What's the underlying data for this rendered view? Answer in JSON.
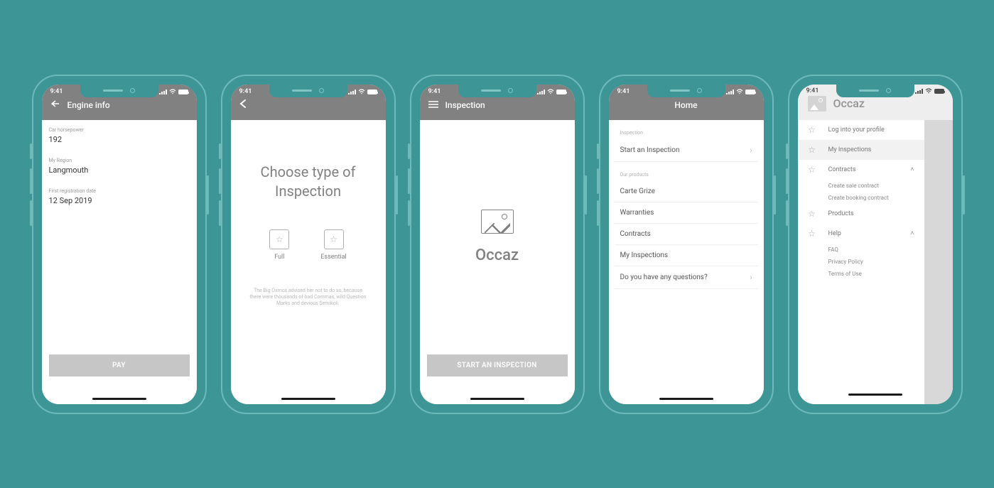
{
  "status_time": "9:41",
  "screen1": {
    "title": "Engine info",
    "field1_label": "Car horsepower",
    "field1_value": "192",
    "field2_label": "My Region",
    "field2_value": "Langmouth",
    "field3_label": "First registration date",
    "field3_value": "12 Sep 2019",
    "button": "PAY"
  },
  "screen2": {
    "headline": "Choose type of Inspection",
    "opt1": "Full",
    "opt2": "Essential",
    "disclaimer": "The Big Oxmox advised her not to do so, because there were thousands of bad Commas, wild Question Marks and devious Semikoli."
  },
  "screen3": {
    "title": "Inspection",
    "brand": "Occaz",
    "button": "START AN INSPECTION"
  },
  "screen4": {
    "title": "Home",
    "section1": "Inspection",
    "row1": "Start an Inspection",
    "section2": "Our products",
    "row2": "Carte Grize",
    "row3": "Warranties",
    "row4": "Contracts",
    "row5": "My Inspections",
    "row6": "Do you have any questions?"
  },
  "screen5": {
    "brand": "Occaz",
    "item1": "Log into your profile",
    "item2": "My Inspections",
    "item3": "Contracts",
    "item3a": "Create sale contract",
    "item3b": "Create booking contract",
    "item4": "Products",
    "item5": "Help",
    "item5a": "FAQ",
    "item5b": "Privacy Policy",
    "item5c": "Terms of Use"
  }
}
